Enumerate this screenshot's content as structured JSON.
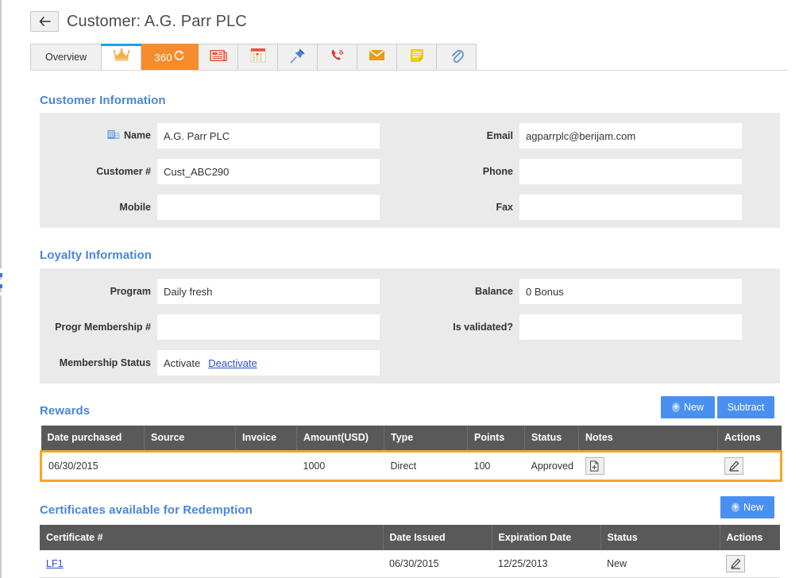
{
  "header": {
    "back_label": "←",
    "title": "Customer: A.G. Parr PLC"
  },
  "tabs": [
    {
      "label": "Overview",
      "icon": "",
      "type": "text",
      "state": "inactive"
    },
    {
      "label": "",
      "icon": "crown-icon",
      "type": "icon",
      "state": "active"
    },
    {
      "label": "360",
      "icon": "refresh-360-icon",
      "type": "orange",
      "state": "inactive"
    },
    {
      "label": "",
      "icon": "newspaper-icon",
      "type": "icon",
      "state": "inactive"
    },
    {
      "label": "",
      "icon": "calendar-icon",
      "type": "icon",
      "state": "inactive"
    },
    {
      "label": "",
      "icon": "pin-icon",
      "type": "icon",
      "state": "inactive"
    },
    {
      "label": "",
      "icon": "phone-icon",
      "type": "icon",
      "state": "inactive"
    },
    {
      "label": "",
      "icon": "envelope-icon",
      "type": "icon",
      "state": "inactive"
    },
    {
      "label": "",
      "icon": "note-icon",
      "type": "icon",
      "state": "inactive"
    },
    {
      "label": "",
      "icon": "paperclip-icon",
      "type": "icon",
      "state": "inactive"
    }
  ],
  "customer_information": {
    "heading": "Customer Information",
    "fields": {
      "name_label": "Name",
      "name_value": "A.G. Parr PLC",
      "customer_no_label": "Customer #",
      "customer_no_value": "Cust_ABC290",
      "mobile_label": "Mobile",
      "mobile_value": "",
      "email_label": "Email",
      "email_value": "agparrplc@berijam.com",
      "phone_label": "Phone",
      "phone_value": "",
      "fax_label": "Fax",
      "fax_value": ""
    }
  },
  "loyalty_information": {
    "heading": "Loyalty Information",
    "fields": {
      "program_label": "Program",
      "program_value": "Daily fresh",
      "progr_membership_label": "Progr Membership #",
      "progr_membership_value": "",
      "membership_status_label": "Membership Status",
      "membership_status_value": "Activate",
      "membership_status_link": "Deactivate",
      "balance_label": "Balance",
      "balance_value": "0 Bonus",
      "is_validated_label": "Is validated?",
      "is_validated_value": ""
    }
  },
  "rewards": {
    "heading": "Rewards",
    "new_label": "New",
    "subtract_label": "Subtract",
    "columns": [
      "Date purchased",
      "Source",
      "Invoice",
      "Amount(USD)",
      "Type",
      "Points",
      "Status",
      "Notes",
      "Actions"
    ],
    "rows": [
      {
        "date_purchased": "06/30/2015",
        "source": "",
        "invoice": "",
        "amount_usd": "1000",
        "type": "Direct",
        "points": "100",
        "status": "Approved",
        "notes": "",
        "highlighted": true
      }
    ]
  },
  "certificates": {
    "heading": "Certificates available for Redemption",
    "new_label": "New",
    "columns": [
      "Certificate #",
      "Date Issued",
      "Expiration Date",
      "Status",
      "Actions"
    ],
    "rows": [
      {
        "certificate_no": "LF1",
        "date_issued": "06/30/2015",
        "expiration_date": "12/25/2013",
        "status": "New"
      }
    ]
  },
  "colors": {
    "accent_blue": "#4a86d6",
    "button_blue": "#4a90f0",
    "tab_orange": "#f68c2c",
    "highlight_orange": "#f5a623",
    "table_header": "#595959",
    "panel_gray": "#eaeaea",
    "active_tab_bar": "#17a3e8"
  }
}
